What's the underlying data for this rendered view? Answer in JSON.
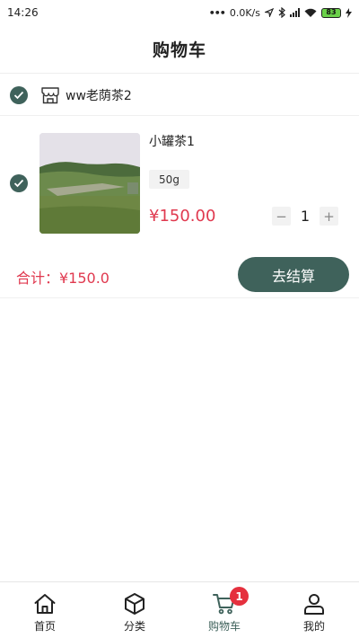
{
  "status_bar": {
    "time": "14:26",
    "network_speed": "0.0K/s",
    "battery": "83"
  },
  "header": {
    "title": "购物车"
  },
  "shop": {
    "name": "ww老荫茶2",
    "checked": true
  },
  "cart_item": {
    "name": "小罐茶1",
    "spec": "50g",
    "price": "¥150.00",
    "quantity": "1",
    "minus_label": "−",
    "plus_label": "+",
    "checked": true
  },
  "summary": {
    "total_label": "合计：¥150.0",
    "checkout_label": "去结算"
  },
  "tabs": [
    {
      "label": "首页",
      "icon": "home-icon"
    },
    {
      "label": "分类",
      "icon": "category-box-icon"
    },
    {
      "label": "购物车",
      "icon": "cart-icon",
      "active": true,
      "badge": "1"
    },
    {
      "label": "我的",
      "icon": "user-icon"
    }
  ],
  "colors": {
    "accent": "#3f625b",
    "price": "#e0394f",
    "badge": "#e5303e"
  }
}
